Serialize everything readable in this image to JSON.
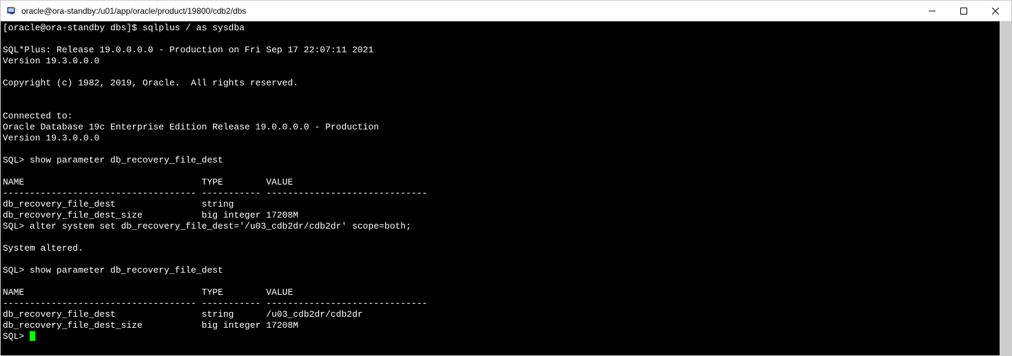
{
  "window": {
    "title": "oracle@ora-standby:/u01/app/oracle/product/19800/cdb2/dbs"
  },
  "terminal": {
    "lines": [
      "[oracle@ora-standby dbs]$ sqlplus / as sysdba",
      "",
      "SQL*Plus: Release 19.0.0.0.0 - Production on Fri Sep 17 22:07:11 2021",
      "Version 19.3.0.0.0",
      "",
      "Copyright (c) 1982, 2019, Oracle.  All rights reserved.",
      "",
      "",
      "Connected to:",
      "Oracle Database 19c Enterprise Edition Release 19.0.0.0.0 - Production",
      "Version 19.3.0.0.0",
      "",
      "SQL> show parameter db_recovery_file_dest",
      "",
      "NAME                                 TYPE        VALUE",
      "------------------------------------ ----------- ------------------------------",
      "db_recovery_file_dest                string",
      "db_recovery_file_dest_size           big integer 17208M",
      "SQL> alter system set db_recovery_file_dest='/u03_cdb2dr/cdb2dr' scope=both;",
      "",
      "System altered.",
      "",
      "SQL> show parameter db_recovery_file_dest",
      "",
      "NAME                                 TYPE        VALUE",
      "------------------------------------ ----------- ------------------------------",
      "db_recovery_file_dest                string      /u03_cdb2dr/cdb2dr",
      "db_recovery_file_dest_size           big integer 17208M"
    ],
    "final_prompt": "SQL> "
  }
}
